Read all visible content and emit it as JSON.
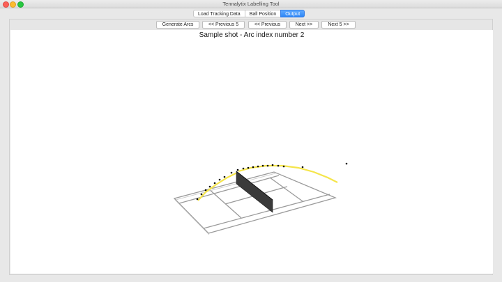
{
  "window": {
    "title": "Tennalytix Labelling Tool"
  },
  "tabs": [
    {
      "label": "Load Tracking Data",
      "active": false
    },
    {
      "label": "Ball Position",
      "active": false
    },
    {
      "label": "Output",
      "active": true
    }
  ],
  "toolbar": {
    "generate_arcs": "Generate Arcs",
    "previous_5": "<< Previous 5",
    "previous": "<< Previous",
    "next": "Next >>",
    "next_5": "Next 5 >>"
  },
  "plot": {
    "title": "Sample shot - Arc index number 2"
  },
  "colors": {
    "accent": "#2f86f6",
    "arc": "#f5e54a",
    "points": "#000000",
    "court_lines": "#9a9a9a",
    "net": "#333333"
  }
}
